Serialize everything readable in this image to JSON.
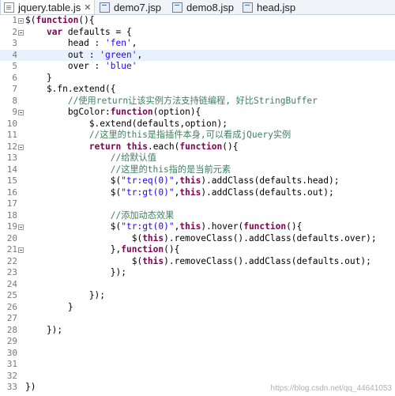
{
  "tabs": [
    {
      "label": "jquery.table.js",
      "active": true,
      "icon": "js-file-icon",
      "close": "✕"
    },
    {
      "label": "demo7.jsp",
      "active": false,
      "icon": "jsp-file-icon"
    },
    {
      "label": "demo8.jsp",
      "active": false,
      "icon": "jsp-file-icon"
    },
    {
      "label": "head.jsp",
      "active": false,
      "icon": "jsp-file-icon"
    }
  ],
  "highlight_line": 4,
  "colors": {
    "keyword": "#7f0055",
    "string": "#2a00ff",
    "comment": "#3f7f5f",
    "current_line": "#e8f2fe"
  },
  "lines": [
    {
      "n": "1",
      "fold": true,
      "tokens": [
        [
          "p",
          "$("
        ],
        [
          "k",
          "function"
        ],
        [
          "p",
          "(){"
        ]
      ]
    },
    {
      "n": "2",
      "fold": true,
      "tokens": [
        [
          "p",
          "    "
        ],
        [
          "k",
          "var"
        ],
        [
          "p",
          " defaults = {"
        ]
      ]
    },
    {
      "n": "3",
      "tokens": [
        [
          "p",
          "        head : "
        ],
        [
          "s",
          "'fen'"
        ],
        [
          "p",
          ","
        ]
      ]
    },
    {
      "n": "4",
      "tokens": [
        [
          "p",
          "        out : "
        ],
        [
          "s",
          "'green'"
        ],
        [
          "p",
          ","
        ]
      ]
    },
    {
      "n": "5",
      "tokens": [
        [
          "p",
          "        over : "
        ],
        [
          "s",
          "'blue'"
        ]
      ]
    },
    {
      "n": "6",
      "tokens": [
        [
          "p",
          "    }"
        ]
      ]
    },
    {
      "n": "7",
      "tokens": [
        [
          "p",
          "    $.fn.extend({"
        ]
      ]
    },
    {
      "n": "8",
      "tokens": [
        [
          "c",
          "        //使用return让该实例方法支持链编程, 好比StringBuffer"
        ]
      ]
    },
    {
      "n": "9",
      "fold": true,
      "tokens": [
        [
          "p",
          "        bgColor:"
        ],
        [
          "k",
          "function"
        ],
        [
          "p",
          "(option){"
        ]
      ]
    },
    {
      "n": "10",
      "tokens": [
        [
          "p",
          "            $.extend(defaults,option);"
        ]
      ]
    },
    {
      "n": "11",
      "tokens": [
        [
          "c",
          "            //这里的this是指插件本身,可以看成jQuery实例"
        ]
      ]
    },
    {
      "n": "12",
      "fold": true,
      "tokens": [
        [
          "p",
          "            "
        ],
        [
          "k",
          "return"
        ],
        [
          "p",
          " "
        ],
        [
          "k",
          "this"
        ],
        [
          "p",
          ".each("
        ],
        [
          "k",
          "function"
        ],
        [
          "p",
          "(){"
        ]
      ]
    },
    {
      "n": "13",
      "tokens": [
        [
          "c",
          "                //给默认值"
        ]
      ]
    },
    {
      "n": "14",
      "tokens": [
        [
          "c",
          "                //这里的this指的是当前元素"
        ]
      ]
    },
    {
      "n": "15",
      "tokens": [
        [
          "p",
          "                $("
        ],
        [
          "s",
          "\"tr:eq(0)\""
        ],
        [
          "p",
          ","
        ],
        [
          "k",
          "this"
        ],
        [
          "p",
          ").addClass(defaults.head);"
        ]
      ]
    },
    {
      "n": "16",
      "tokens": [
        [
          "p",
          "                $("
        ],
        [
          "s",
          "\"tr:gt(0)\""
        ],
        [
          "p",
          ","
        ],
        [
          "k",
          "this"
        ],
        [
          "p",
          ").addClass(defaults.out);"
        ]
      ]
    },
    {
      "n": "17",
      "tokens": []
    },
    {
      "n": "18",
      "tokens": [
        [
          "c",
          "                //添加动态效果"
        ]
      ]
    },
    {
      "n": "19",
      "fold": true,
      "tokens": [
        [
          "p",
          "                $("
        ],
        [
          "s",
          "\"tr:gt(0)\""
        ],
        [
          "p",
          ","
        ],
        [
          "k",
          "this"
        ],
        [
          "p",
          ").hover("
        ],
        [
          "k",
          "function"
        ],
        [
          "p",
          "(){"
        ]
      ]
    },
    {
      "n": "20",
      "tokens": [
        [
          "p",
          "                    $("
        ],
        [
          "k",
          "this"
        ],
        [
          "p",
          ").removeClass().addClass(defaults.over);"
        ]
      ]
    },
    {
      "n": "21",
      "fold": true,
      "tokens": [
        [
          "p",
          "                },"
        ],
        [
          "k",
          "function"
        ],
        [
          "p",
          "(){"
        ]
      ]
    },
    {
      "n": "22",
      "tokens": [
        [
          "p",
          "                    $("
        ],
        [
          "k",
          "this"
        ],
        [
          "p",
          ").removeClass().addClass(defaults.out);"
        ]
      ]
    },
    {
      "n": "23",
      "tokens": [
        [
          "p",
          "                });"
        ]
      ]
    },
    {
      "n": "24",
      "tokens": []
    },
    {
      "n": "25",
      "tokens": [
        [
          "p",
          "            });"
        ]
      ]
    },
    {
      "n": "26",
      "tokens": [
        [
          "p",
          "        }"
        ]
      ]
    },
    {
      "n": "27",
      "tokens": []
    },
    {
      "n": "28",
      "tokens": [
        [
          "p",
          "    });"
        ]
      ]
    },
    {
      "n": "29",
      "tokens": []
    },
    {
      "n": "30",
      "tokens": []
    },
    {
      "n": "31",
      "tokens": []
    },
    {
      "n": "32",
      "tokens": []
    },
    {
      "n": "33",
      "tokens": [
        [
          "p",
          "})"
        ]
      ]
    }
  ],
  "watermark": "https://blog.csdn.net/qq_44641053"
}
